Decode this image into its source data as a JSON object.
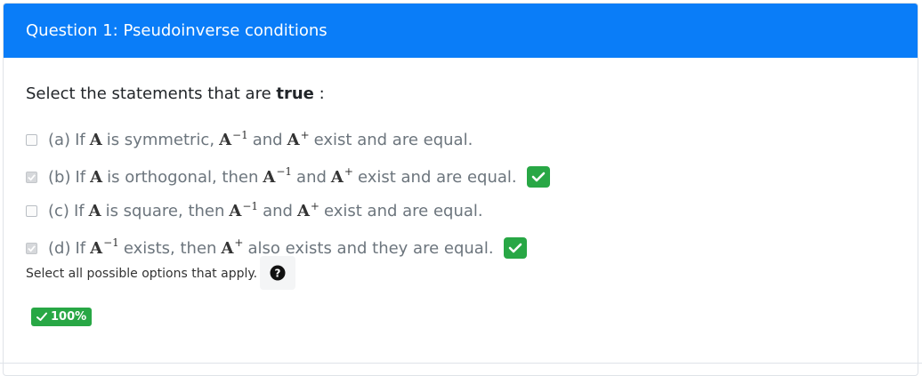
{
  "question": {
    "title": "Question 1: Pseudoinverse conditions"
  },
  "prompt": {
    "text": "Select the statements that are ",
    "emphasis": "true",
    "suffix": " :"
  },
  "options": [
    {
      "label": "(a)",
      "checked": false,
      "correct": false,
      "parts": [
        "If",
        "A",
        "is symmetric,",
        "A",
        "−1",
        "and",
        "A",
        "+",
        "exist and are equal."
      ]
    },
    {
      "label": "(b)",
      "checked": true,
      "correct": true,
      "parts": [
        "If",
        "A",
        "is orthogonal, then",
        "A",
        "−1",
        "and",
        "A",
        "+",
        "exist and are equal."
      ]
    },
    {
      "label": "(c)",
      "checked": false,
      "correct": false,
      "parts": [
        "If",
        "A",
        "is square, then",
        "A",
        "−1",
        "and",
        "A",
        "+",
        "exist and are equal."
      ]
    },
    {
      "label": "(d)",
      "checked": true,
      "correct": true,
      "parts": [
        "If",
        "A",
        "−1",
        "exists, then",
        "A",
        "+",
        "also exists and they are equal."
      ]
    }
  ],
  "helper": {
    "text": "Select all possible options that apply."
  },
  "score": {
    "value": "100%"
  },
  "colors": {
    "header": "#0a7df8",
    "success": "#28a745"
  },
  "icons": {
    "help": "question-circle-icon",
    "check": "check-icon"
  }
}
